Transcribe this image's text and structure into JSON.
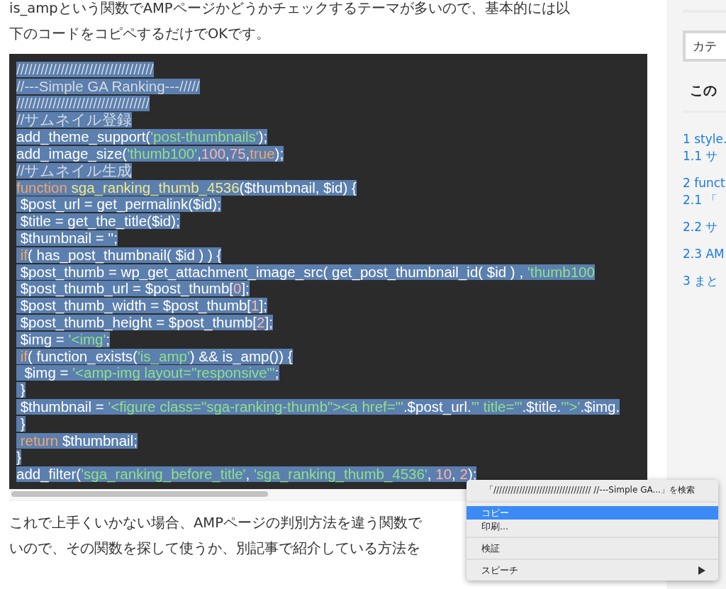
{
  "article": {
    "intro_lines": [
      "is_ampという関数でAMPページかどうかチェックするテーマが多いので、基本的には以",
      "下のコードをコピペするだけでOKです。"
    ],
    "code_lines": [
      {
        "selected": true,
        "tokens": [
          {
            "kind": "comment",
            "text": "//////////////////////////////////"
          }
        ]
      },
      {
        "selected": true,
        "tokens": [
          {
            "kind": "comment",
            "text": "//---Simple GA Ranking---/////"
          }
        ]
      },
      {
        "selected": true,
        "tokens": [
          {
            "kind": "comment",
            "text": "/////////////////////////////////"
          }
        ]
      },
      {
        "selected": true,
        "tokens": [
          {
            "kind": "comment",
            "text": "//サムネイル登録"
          }
        ]
      },
      {
        "selected": true,
        "tokens": [
          {
            "kind": "plain",
            "text": "add_theme_support("
          },
          {
            "kind": "string",
            "text": "'post-thumbnails'"
          },
          {
            "kind": "plain",
            "text": ");"
          }
        ]
      },
      {
        "selected": true,
        "tokens": [
          {
            "kind": "plain",
            "text": "add_image_size("
          },
          {
            "kind": "string",
            "text": "'thumb100'"
          },
          {
            "kind": "plain",
            "text": ","
          },
          {
            "kind": "number",
            "text": "100"
          },
          {
            "kind": "plain",
            "text": ","
          },
          {
            "kind": "number",
            "text": "75"
          },
          {
            "kind": "plain",
            "text": ","
          },
          {
            "kind": "keyword",
            "text": "true"
          },
          {
            "kind": "plain",
            "text": ");"
          }
        ]
      },
      {
        "selected": true,
        "tokens": [
          {
            "kind": "comment",
            "text": "//サムネイル生成"
          }
        ]
      },
      {
        "selected": true,
        "tokens": [
          {
            "kind": "keyword",
            "text": "function"
          },
          {
            "kind": "func",
            "text": " sga_ranking_thumb_4536"
          },
          {
            "kind": "plain",
            "text": "($thumbnail, $id) {"
          }
        ]
      },
      {
        "selected": true,
        "tokens": [
          {
            "kind": "plain",
            "text": " $post_url = get_permalink($id);"
          }
        ]
      },
      {
        "selected": true,
        "tokens": [
          {
            "kind": "plain",
            "text": " $title = get_the_title($id);"
          }
        ]
      },
      {
        "selected": true,
        "tokens": [
          {
            "kind": "plain",
            "text": " $thumbnail = '';"
          }
        ]
      },
      {
        "selected": true,
        "tokens": [
          {
            "kind": "keyword",
            "text": " if"
          },
          {
            "kind": "plain",
            "text": "( has_post_thumbnail( $id ) ) {"
          }
        ]
      },
      {
        "selected": true,
        "tokens": [
          {
            "kind": "plain",
            "text": " $post_thumb = wp_get_attachment_image_src( get_post_thumbnail_id( $id ) , "
          },
          {
            "kind": "string",
            "text": "'thumb100"
          }
        ]
      },
      {
        "selected": true,
        "tokens": [
          {
            "kind": "plain",
            "text": " $post_thumb_url = $post_thumb["
          },
          {
            "kind": "number",
            "text": "0"
          },
          {
            "kind": "plain",
            "text": "];"
          }
        ]
      },
      {
        "selected": true,
        "tokens": [
          {
            "kind": "plain",
            "text": " $post_thumb_width = $post_thumb["
          },
          {
            "kind": "number",
            "text": "1"
          },
          {
            "kind": "plain",
            "text": "];"
          }
        ]
      },
      {
        "selected": true,
        "tokens": [
          {
            "kind": "plain",
            "text": " $post_thumb_height = $post_thumb["
          },
          {
            "kind": "number",
            "text": "2"
          },
          {
            "kind": "plain",
            "text": "];"
          }
        ]
      },
      {
        "selected": true,
        "tokens": [
          {
            "kind": "plain",
            "text": " $img = "
          },
          {
            "kind": "string",
            "text": "'<img'"
          },
          {
            "kind": "plain",
            "text": ";"
          }
        ]
      },
      {
        "selected": true,
        "tokens": [
          {
            "kind": "keyword",
            "text": " if"
          },
          {
            "kind": "plain",
            "text": "( function_exists("
          },
          {
            "kind": "string",
            "text": "'is_amp'"
          },
          {
            "kind": "plain",
            "text": ") && is_amp()) {"
          }
        ]
      },
      {
        "selected": true,
        "tokens": [
          {
            "kind": "plain",
            "text": "  $img = "
          },
          {
            "kind": "string",
            "text": "'<amp-img layout=\"responsive\"'"
          },
          {
            "kind": "plain",
            "text": ";"
          }
        ]
      },
      {
        "selected": true,
        "tokens": [
          {
            "kind": "plain",
            "text": " }"
          }
        ]
      },
      {
        "selected": true,
        "tokens": [
          {
            "kind": "plain",
            "text": " $thumbnail = "
          },
          {
            "kind": "string",
            "text": "'<figure class=\"sga-ranking-thumb\"><a href=\"'"
          },
          {
            "kind": "plain",
            "text": ".$post_url."
          },
          {
            "kind": "string",
            "text": "'\" title=\"'"
          },
          {
            "kind": "plain",
            "text": ".$title."
          },
          {
            "kind": "string",
            "text": "'\">'"
          },
          {
            "kind": "plain",
            "text": ".$img."
          }
        ]
      },
      {
        "selected": true,
        "tokens": [
          {
            "kind": "plain",
            "text": " }"
          }
        ]
      },
      {
        "selected": true,
        "tokens": [
          {
            "kind": "keyword",
            "text": " return"
          },
          {
            "kind": "plain",
            "text": " $thumbnail;"
          }
        ]
      },
      {
        "selected": true,
        "tokens": [
          {
            "kind": "plain",
            "text": "}"
          }
        ]
      },
      {
        "selected": true,
        "tokens": [
          {
            "kind": "plain",
            "text": "add_filter("
          },
          {
            "kind": "string",
            "text": "'sga_ranking_before_title'"
          },
          {
            "kind": "plain",
            "text": ", "
          },
          {
            "kind": "string",
            "text": "'sga_ranking_thumb_4536'"
          },
          {
            "kind": "plain",
            "text": ", "
          },
          {
            "kind": "number",
            "text": "10"
          },
          {
            "kind": "plain",
            "text": ", "
          },
          {
            "kind": "number",
            "text": "2"
          },
          {
            "kind": "plain",
            "text": ");"
          }
        ]
      }
    ],
    "outro_lines": [
      "これで上手くいかない場合、AMPページの判別方法を違う関数で",
      "いので、その関数を探して使うか、別記事で紹介している方法を"
    ]
  },
  "sidebar": {
    "category_select": "カテ",
    "toc_heading": "この",
    "toc_groups": [
      [
        "1 style.",
        "1.1 サ"
      ],
      [
        "2 funct",
        "2.1 「"
      ],
      [
        "2.2 サ"
      ],
      [
        "2.3 AM"
      ],
      [
        "3 まと"
      ]
    ]
  },
  "context_menu": {
    "groups": [
      [
        {
          "label": "「////////////////////////////////// //---Simple GA...」を検索",
          "selected": false,
          "submenu": false
        }
      ],
      [
        {
          "label": "コピー",
          "selected": true,
          "submenu": false
        },
        {
          "label": "印刷...",
          "selected": false,
          "submenu": false
        }
      ],
      [
        {
          "label": "検証",
          "selected": false,
          "submenu": false
        }
      ],
      [
        {
          "label": "スピーチ",
          "selected": false,
          "submenu": true
        }
      ]
    ]
  }
}
